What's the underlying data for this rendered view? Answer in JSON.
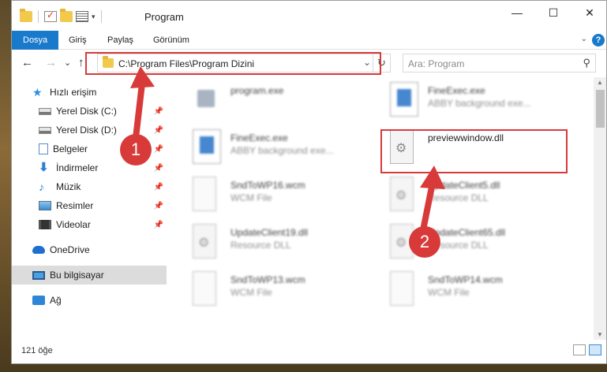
{
  "window": {
    "title": "Program",
    "controls": {
      "minimize": "—",
      "maximize": "☐",
      "close": "✕"
    }
  },
  "ribbon": {
    "tabs": [
      {
        "label": "Dosya",
        "active": true
      },
      {
        "label": "Giriş"
      },
      {
        "label": "Paylaş"
      },
      {
        "label": "Görünüm"
      }
    ],
    "help": "?"
  },
  "nav": {
    "back": "←",
    "forward": "→",
    "recent": "⌄",
    "up": "↑",
    "address": "C:\\Program Files\\Program Dizini",
    "address_dropdown": "⌄",
    "refresh": "↻",
    "search_placeholder": "Ara: Program",
    "search_icon": "search-icon"
  },
  "sidebar": {
    "items": [
      {
        "label": "Hızlı erişim",
        "icon": "star-icon"
      },
      {
        "label": "Yerel Disk (C:)",
        "icon": "disk-icon",
        "pinned": true
      },
      {
        "label": "Yerel Disk (D:)",
        "icon": "disk-icon",
        "pinned": true
      },
      {
        "label": "Belgeler",
        "icon": "document-icon",
        "pinned": true
      },
      {
        "label": "İndirmeler",
        "icon": "download-icon",
        "pinned": true
      },
      {
        "label": "Müzik",
        "icon": "music-icon",
        "pinned": true
      },
      {
        "label": "Resimler",
        "icon": "pictures-icon",
        "pinned": true
      },
      {
        "label": "Videolar",
        "icon": "video-icon",
        "pinned": true
      },
      {
        "label": "OneDrive",
        "icon": "cloud-icon"
      },
      {
        "label": "Bu bilgisayar",
        "icon": "pc-icon",
        "selected": true
      },
      {
        "label": "Ağ",
        "icon": "network-icon"
      }
    ],
    "pin_glyph": "📌"
  },
  "files": [
    {
      "name": "program.exe",
      "desc": ""
    },
    {
      "name": "FineExec.exe",
      "desc": "ABBY background exe..."
    },
    {
      "name": "FineExec.exe",
      "desc": "ABBY background exe..."
    },
    {
      "name": "previewwindow.dll",
      "desc": ""
    },
    {
      "name": "SndToWP16.wcm",
      "desc": "WCM File"
    },
    {
      "name": "UpdateClient5.dll",
      "desc": "Resource DLL"
    },
    {
      "name": "UpdateClient19.dll",
      "desc": "Resource DLL"
    },
    {
      "name": "UpdateClient65.dll",
      "desc": "Resource DLL"
    },
    {
      "name": "SndToWP13.wcm",
      "desc": "WCM File"
    },
    {
      "name": "SndToWP14.wcm",
      "desc": "WCM File"
    }
  ],
  "status": {
    "count": "121 öğe"
  },
  "annotations": {
    "step1": "1",
    "step2": "2",
    "color": "#d83a3a"
  }
}
